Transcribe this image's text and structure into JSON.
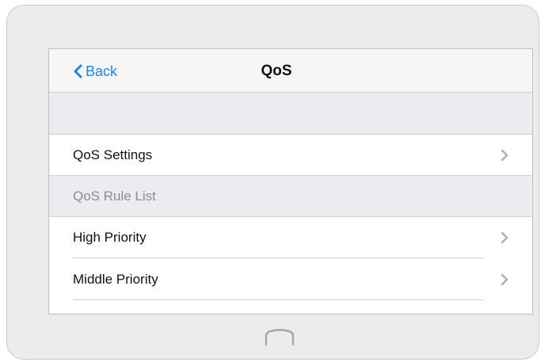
{
  "navbar": {
    "back_label": "Back",
    "title": "QoS"
  },
  "settings_row": {
    "label": "QoS Settings"
  },
  "rule_list_section": {
    "label": "QoS Rule List"
  },
  "rules": [
    {
      "label": "High Priority"
    },
    {
      "label": "Middle Priority"
    }
  ],
  "colors": {
    "accent": "#1f86f0",
    "frame": "#ececec",
    "section_bg": "#ececf0"
  },
  "icons": {
    "back": "chevron-left-icon",
    "row": "chevron-right-icon",
    "home": "home-button-icon"
  }
}
